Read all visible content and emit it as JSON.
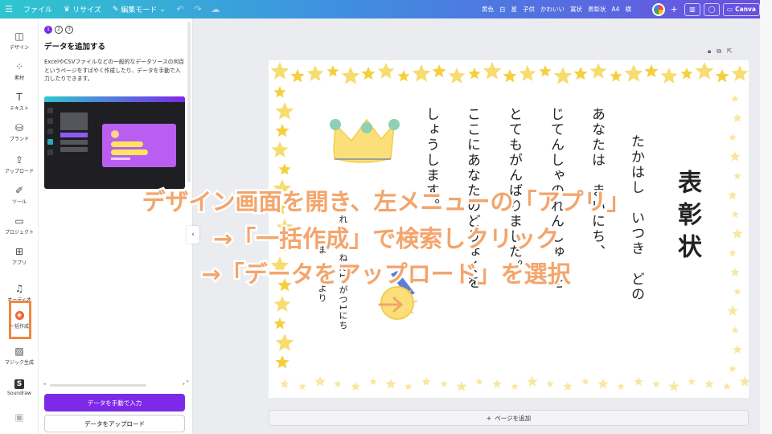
{
  "topbar": {
    "file": "ファイル",
    "resize": "リサイズ",
    "edit_mode": "編集モード",
    "tags": [
      "黄色",
      "白",
      "星",
      "子供",
      "かわいい",
      "賞状",
      "表彰状",
      "A4",
      "横"
    ],
    "canva_label": "Canva",
    "colors": {
      "gradient_start": "#2ec6cf",
      "gradient_mid": "#3f8fe0",
      "gradient_end": "#6a4fe0"
    }
  },
  "rail": {
    "items": [
      {
        "label": "デザイン",
        "icon": "layout-icon"
      },
      {
        "label": "素材",
        "icon": "shapes-icon"
      },
      {
        "label": "テキスト",
        "icon": "text-icon"
      },
      {
        "label": "ブランド",
        "icon": "brand-icon"
      },
      {
        "label": "アップロード",
        "icon": "upload-icon"
      },
      {
        "label": "ツール",
        "icon": "pen-icon"
      },
      {
        "label": "プロジェクト",
        "icon": "folder-icon"
      },
      {
        "label": "アプリ",
        "icon": "apps-icon"
      },
      {
        "label": "オーディオ",
        "icon": "music-icon"
      },
      {
        "label": "一括作成",
        "icon": "bulk-create-icon"
      },
      {
        "label": "マジック生成",
        "icon": "magic-image-icon"
      },
      {
        "label": "Soundraw",
        "icon": "soundraw-icon"
      }
    ],
    "highlight_color": "#f0883e"
  },
  "panel": {
    "steps": [
      "1",
      "2",
      "3"
    ],
    "title": "データを追加する",
    "description": "ExcelやCSVファイルなどの一般的なデータソースの何百というページをすばやく作成したり、データを手動で入力したりできます。",
    "btn_manual": "データを手動で入力",
    "btn_upload": "データをアップロード",
    "accent": "#7d2ae8"
  },
  "workspace": {
    "add_page": "ページを追加"
  },
  "certificate": {
    "title": "表彰状",
    "to_line": "たかはし　いつき　どの",
    "body": [
      "あなたは　まいにち、",
      "じてんしゃのれんしゅうを",
      "とてもがんばりました。",
      "ここにあなたのどりょくを",
      "しょうします。"
    ],
    "date": "れいわ　ねん10がつ1にち",
    "from": "まま　ぱぱより"
  },
  "overlay": {
    "line1": "デザイン画面を開き、左メニューの「アプリ」",
    "line2": "→「一括作成」で検索しクリック",
    "line3": "→「データをアップロード」を選択",
    "color": "#f3a56c"
  }
}
